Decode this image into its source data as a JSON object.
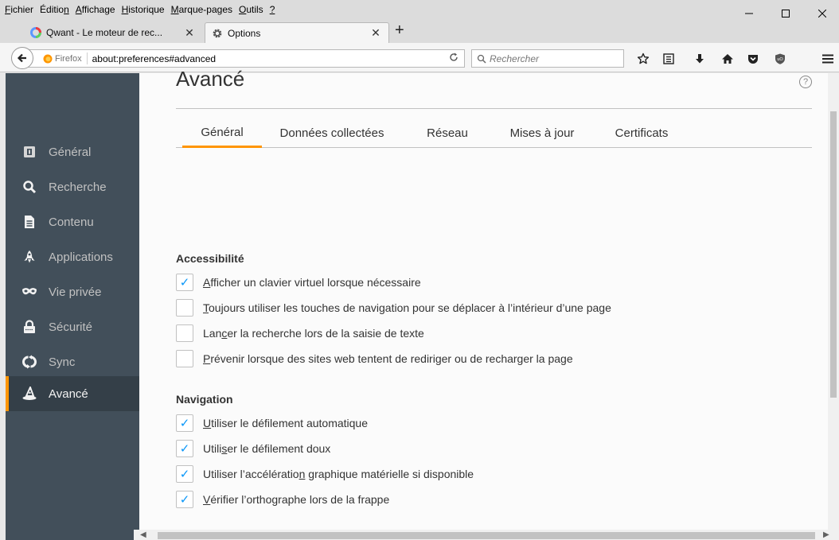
{
  "menubar": {
    "items": [
      {
        "name": "menu-fichier",
        "pre": "",
        "u": "F",
        "post": "ichier"
      },
      {
        "name": "menu-edition",
        "pre": "Éditio",
        "u": "n",
        "post": ""
      },
      {
        "name": "menu-affichage",
        "pre": "",
        "u": "A",
        "post": "ffichage"
      },
      {
        "name": "menu-historique",
        "pre": "",
        "u": "H",
        "post": "istorique"
      },
      {
        "name": "menu-marque-pages",
        "pre": "",
        "u": "M",
        "post": "arque-pages"
      },
      {
        "name": "menu-outils",
        "pre": "",
        "u": "O",
        "post": "utils"
      },
      {
        "name": "menu-help",
        "pre": "",
        "u": "?",
        "post": ""
      }
    ]
  },
  "tabs": {
    "inactive_title": "Qwant - Le moteur de rec...",
    "active_title": "Options",
    "close_glyph": "✕",
    "new_tab_glyph": "+"
  },
  "navbar": {
    "identity_label": "Firefox",
    "url": "about:preferences#advanced",
    "search_placeholder": "Rechercher"
  },
  "sidebar": {
    "categories": [
      {
        "name": "cat-general",
        "label": "Général",
        "icon": "general-icon"
      },
      {
        "name": "cat-recherche",
        "label": "Recherche",
        "icon": "search-icon"
      },
      {
        "name": "cat-contenu",
        "label": "Contenu",
        "icon": "document-icon"
      },
      {
        "name": "cat-applications",
        "label": "Applications",
        "icon": "rocket-icon"
      },
      {
        "name": "cat-vie-privee",
        "label": "Vie privée",
        "icon": "mask-icon"
      },
      {
        "name": "cat-securite",
        "label": "Sécurité",
        "icon": "lock-icon"
      },
      {
        "name": "cat-sync",
        "label": "Sync",
        "icon": "sync-icon"
      },
      {
        "name": "cat-avance",
        "label": "Avancé",
        "icon": "wizard-hat-icon",
        "selected": true
      }
    ]
  },
  "main": {
    "title": "Avancé",
    "help_glyph": "?",
    "tabs": [
      "Général",
      "Données collectées",
      "Réseau",
      "Mises à jour",
      "Certificats"
    ],
    "active_tab": "Général",
    "groups": [
      {
        "title": "Accessibilité",
        "items": [
          {
            "checked": true,
            "pre": "",
            "u": "A",
            "post": "fficher un clavier virtuel lorsque nécessaire"
          },
          {
            "checked": false,
            "pre": "",
            "u": "T",
            "post": "oujours utiliser les touches de navigation pour se déplacer à l’intérieur d’une page"
          },
          {
            "checked": false,
            "pre": "Lan",
            "u": "c",
            "post": "er la recherche lors de la saisie de texte"
          },
          {
            "checked": false,
            "pre": "",
            "u": "P",
            "post": "révenir lorsque des sites web tentent de rediriger ou de recharger la page"
          }
        ]
      },
      {
        "title": "Navigation",
        "items": [
          {
            "checked": true,
            "pre": "",
            "u": "U",
            "post": "tiliser le défilement automatique"
          },
          {
            "checked": true,
            "pre": "Utili",
            "u": "s",
            "post": "er le défilement doux"
          },
          {
            "checked": true,
            "pre": "Utiliser l’accélératio",
            "u": "n",
            "post": " graphique matérielle si disponible"
          },
          {
            "checked": true,
            "pre": "",
            "u": "V",
            "post": "érifier l’orthographe lors de la frappe"
          }
        ]
      }
    ]
  },
  "colors": {
    "sidebar_bg": "#424f5a",
    "sidebar_selected_bg": "#343f48",
    "accent": "#ff9500",
    "check_blue": "#0996f8"
  }
}
